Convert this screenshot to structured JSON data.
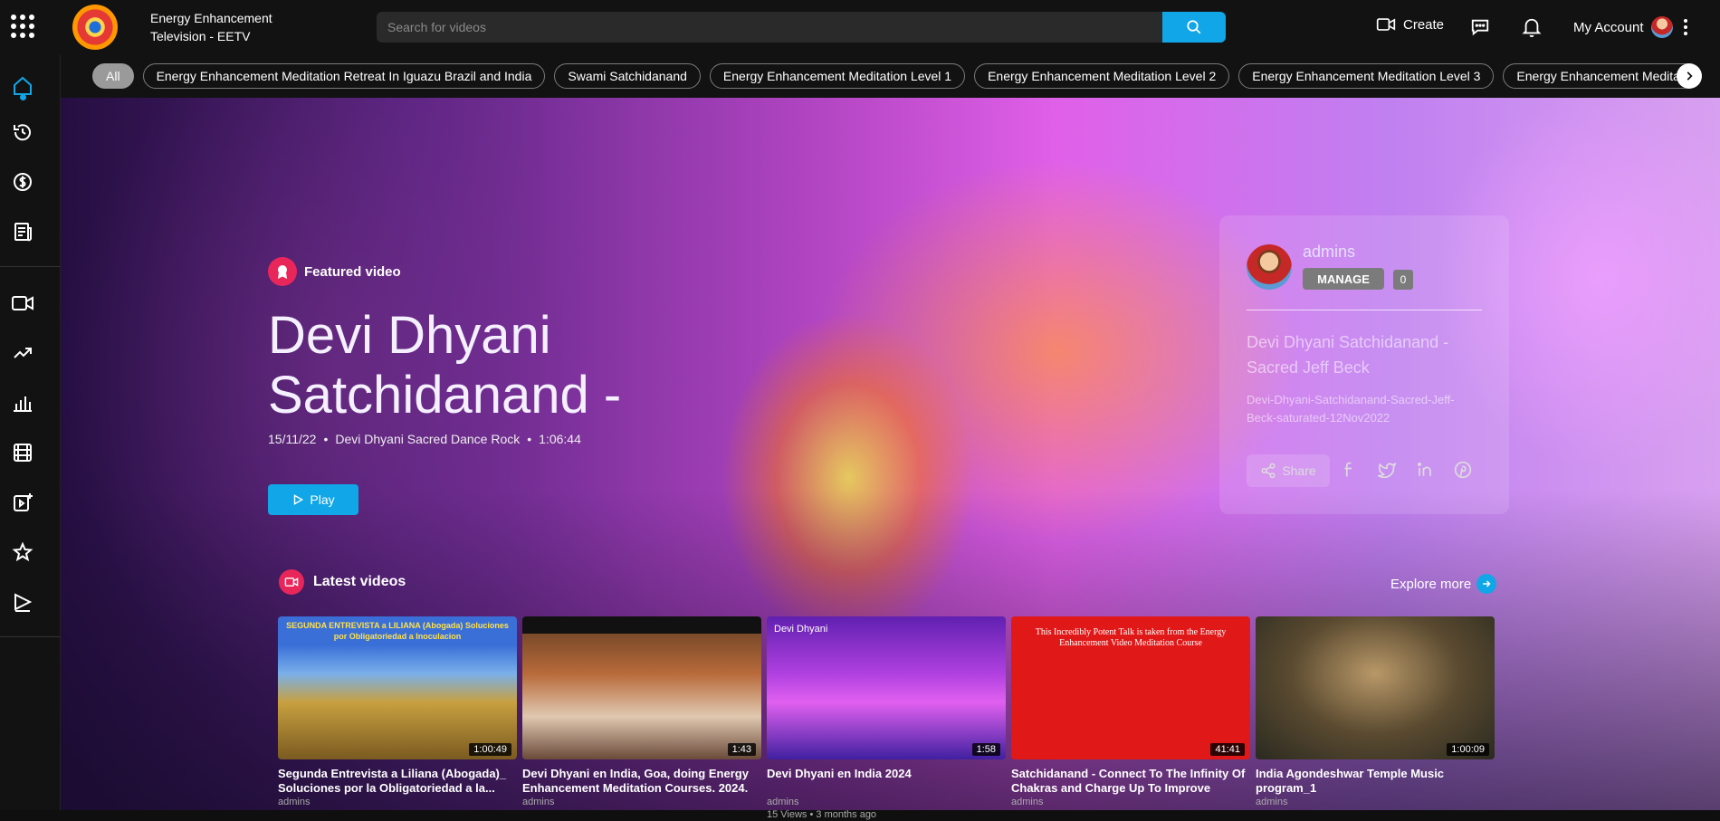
{
  "header": {
    "brand": "Energy Enhancement Television - EETV",
    "search_placeholder": "Search for videos",
    "create_label": "Create",
    "account_label": "My Account"
  },
  "chips": {
    "all": "All",
    "items": [
      "Energy Enhancement Meditation Retreat In Iguazu Brazil and India",
      "Swami Satchidanand",
      "Energy Enhancement Meditation Level 1",
      "Energy Enhancement Meditation Level 2",
      "Energy Enhancement Meditation Level 3",
      "Energy Enhancement Meditati"
    ]
  },
  "featured": {
    "label": "Featured video",
    "title": "Devi Dhyani Satchidanand -",
    "date": "15/11/22",
    "channel": "Devi Dhyani Sacred Dance Rock",
    "duration": "1:06:44",
    "play_label": "Play"
  },
  "card": {
    "user": "admins",
    "manage_label": "MANAGE",
    "manage_count": "0",
    "title": "Devi Dhyani Satchidanand - Sacred Jeff Beck",
    "slug": "Devi-Dhyani-Satchidanand-Sacred-Jeff-Beck-saturated-12Nov2022",
    "share_label": "Share"
  },
  "latest": {
    "label": "Latest videos",
    "explore_label": "Explore more",
    "videos": [
      {
        "title": "Segunda Entrevista a Liliana (Abogada)_ Soluciones por la Obligatoriedad a la...",
        "author": "admins",
        "meta": "",
        "duration": "1:00:49",
        "thumb_text": "SEGUNDA ENTREVISTA a LILIANA (Abogada) Soluciones por Obligatoriedad a Inoculacion"
      },
      {
        "title": "Devi Dhyani en India, Goa, doing Energy Enhancement Meditation Courses. 2024.",
        "author": "admins",
        "meta": "",
        "duration": "1:43",
        "thumb_text": ""
      },
      {
        "title": "Devi Dhyani en India 2024",
        "author": "admins",
        "meta": "15 Views • 3 months ago",
        "duration": "1:58",
        "thumb_text": "Devi Dhyani"
      },
      {
        "title": "Satchidanand - Connect To The Infinity Of Chakras and Charge Up To Improve Love...",
        "author": "admins",
        "meta": "",
        "duration": "41:41",
        "thumb_text": "This Incredibly Potent Talk is taken from the Energy Enhancement Video Meditation Course"
      },
      {
        "title": "India Agondeshwar Temple Music program_1",
        "author": "admins",
        "meta": "",
        "duration": "1:00:09",
        "thumb_text": ""
      }
    ]
  }
}
